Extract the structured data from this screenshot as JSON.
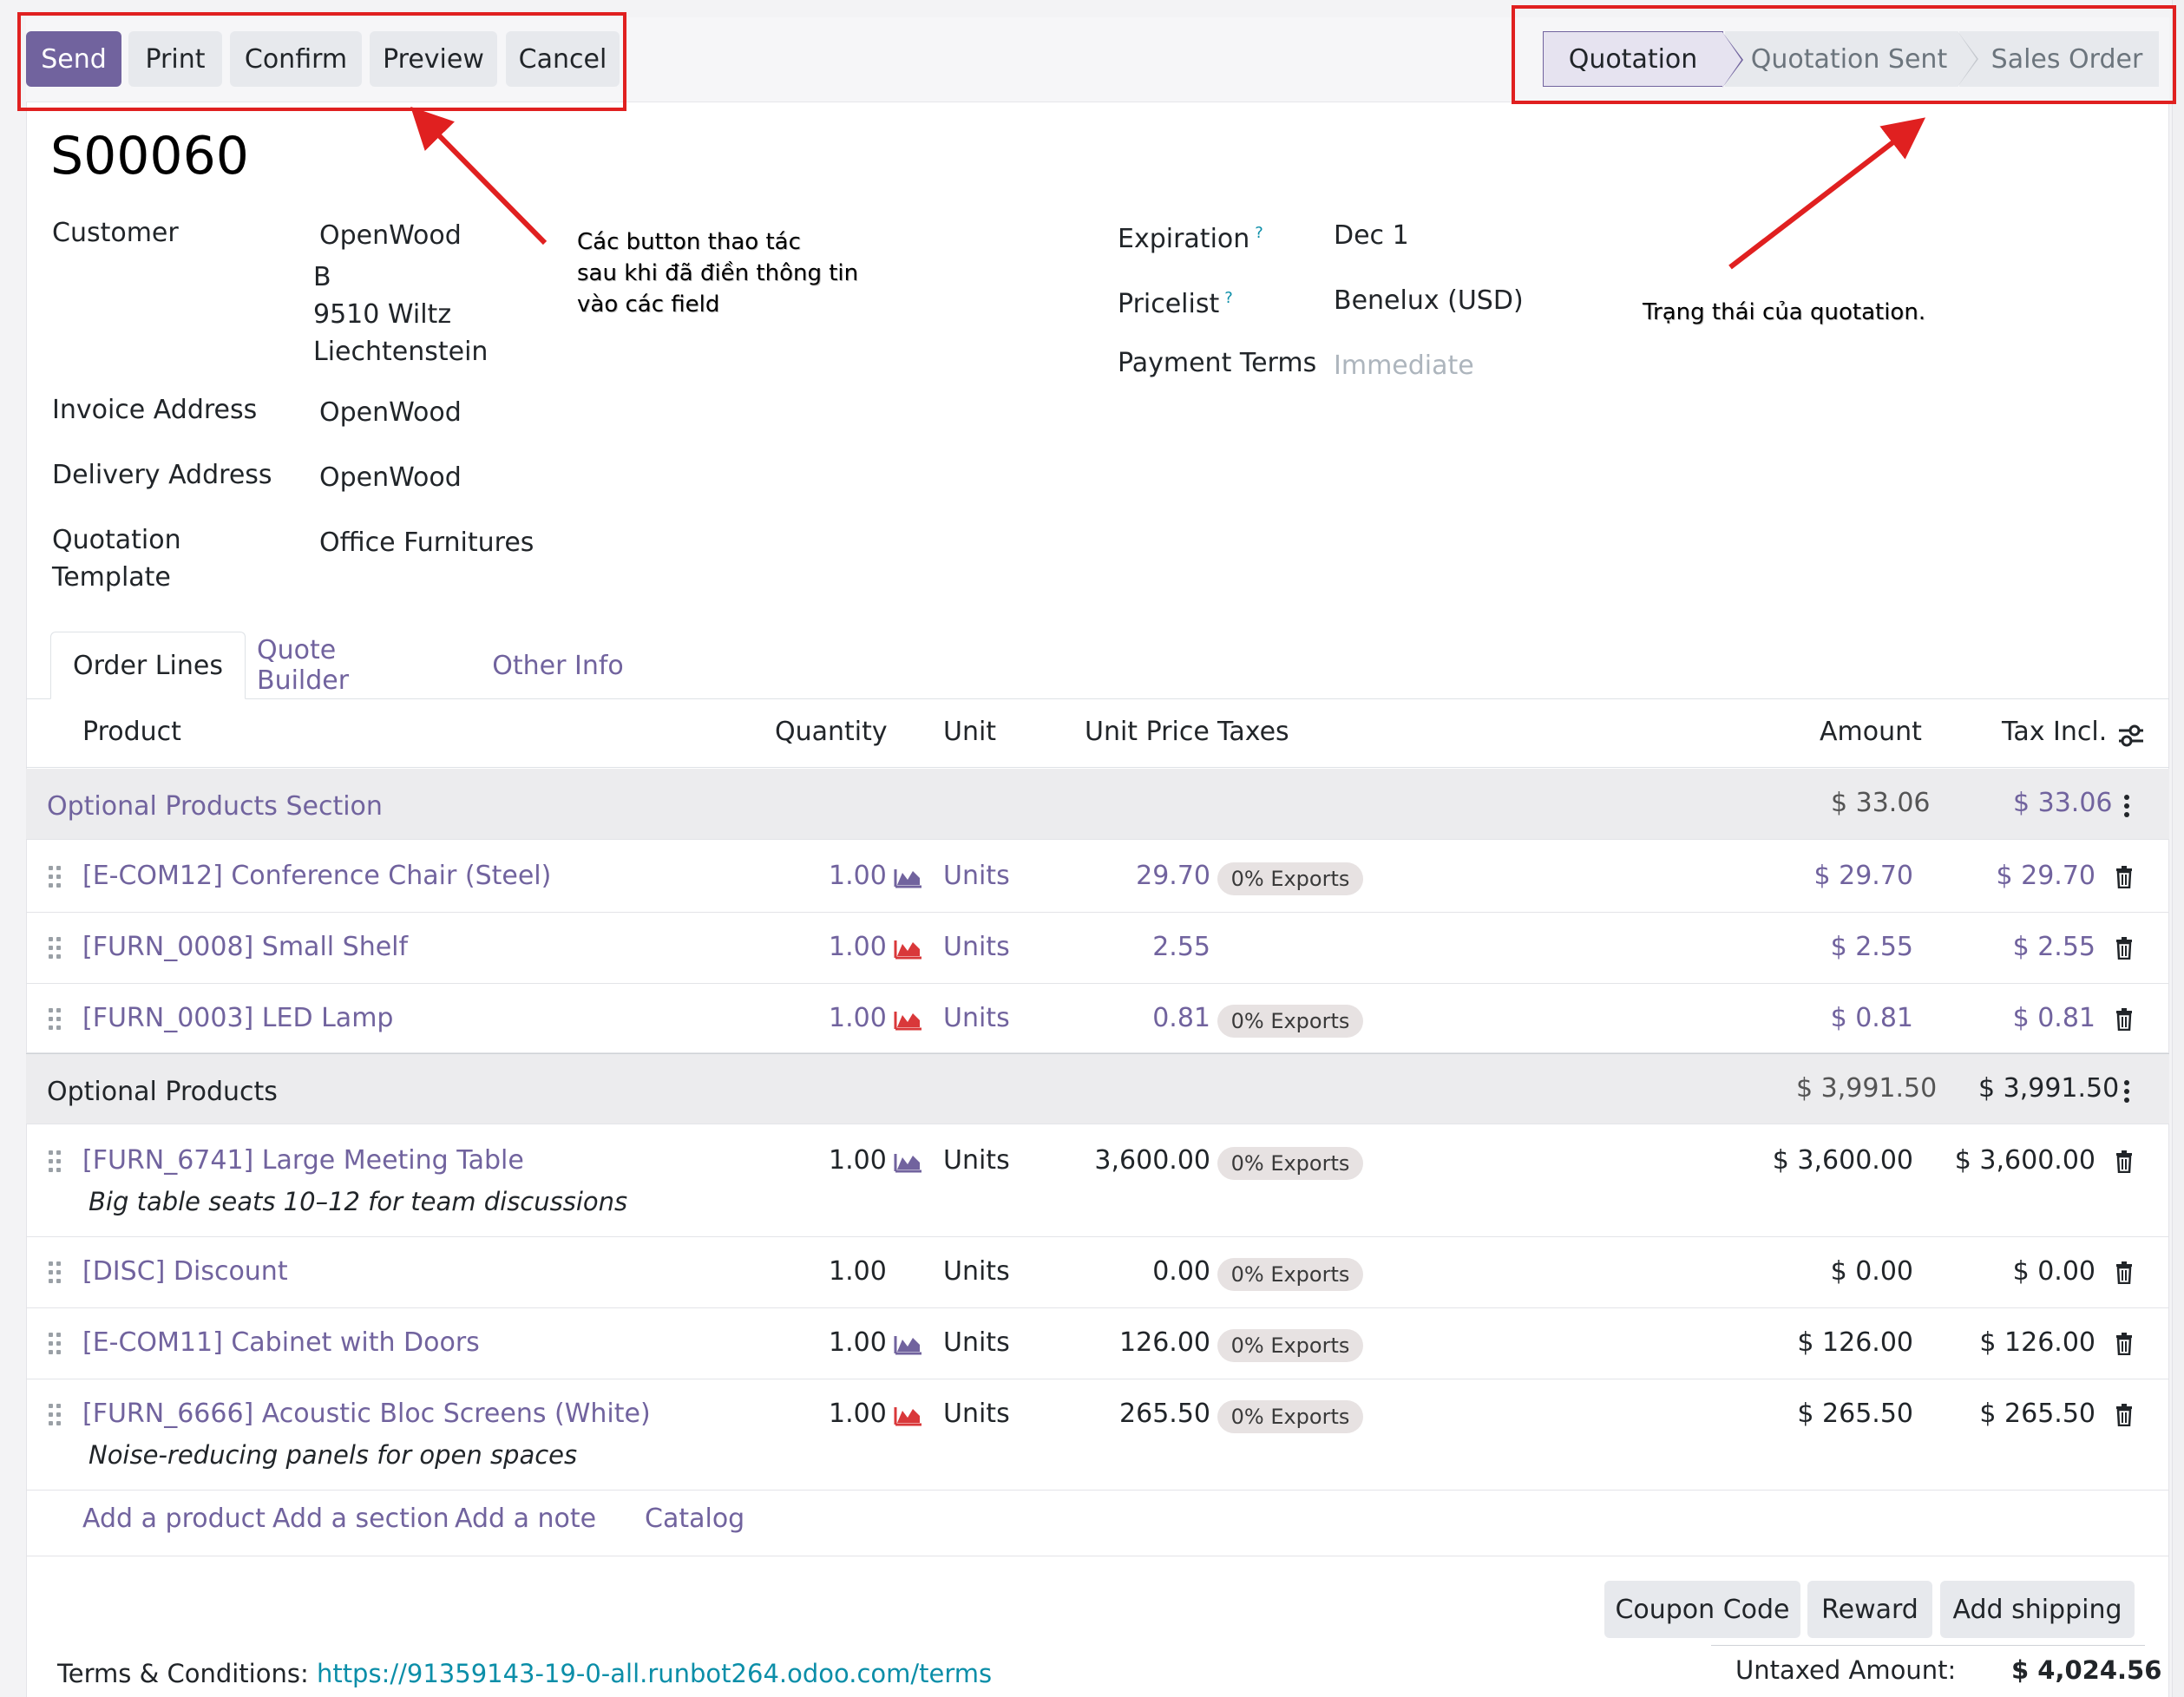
{
  "toolbar": {
    "send": "Send",
    "print": "Print",
    "confirm": "Confirm",
    "preview": "Preview",
    "cancel": "Cancel"
  },
  "statusbar": {
    "stages": [
      "Quotation",
      "Quotation Sent",
      "Sales Order"
    ],
    "active": "Quotation"
  },
  "annotations": {
    "buttons_note": "Các button thao tác\nsau khi đã điền thông tin\nvào các field",
    "status_note": "Trạng thái của quotation."
  },
  "record": {
    "name": "S00060",
    "customer_label": "Customer",
    "customer_name": "OpenWood",
    "customer_addr1": "B",
    "customer_addr2": "9510 Wiltz",
    "customer_addr3": "Liechtenstein",
    "invoice_label": "Invoice Address",
    "invoice_value": "OpenWood",
    "delivery_label": "Delivery Address",
    "delivery_value": "OpenWood",
    "template_label_1": "Quotation",
    "template_label_2": "Template",
    "template_value": "Office Furnitures",
    "expiration_label": "Expiration",
    "expiration_value": "Dec 1",
    "pricelist_label": "Pricelist",
    "pricelist_value": "Benelux (USD)",
    "payment_terms_label": "Payment Terms",
    "payment_terms_placeholder": "Immediate",
    "help_mark": "?"
  },
  "tabs": [
    "Order Lines",
    "Quote Builder",
    "Other Info"
  ],
  "table": {
    "headers": {
      "product": "Product",
      "quantity": "Quantity",
      "unit": "Unit",
      "unit_price": "Unit Price",
      "taxes": "Taxes",
      "amount": "Amount",
      "tax_incl": "Tax Incl."
    },
    "sections": [
      {
        "name": "Optional Products Section",
        "amount": "$ 33.06",
        "tax_incl": "$ 33.06"
      },
      {
        "name": "Optional Products",
        "amount": "$ 3,991.50",
        "tax_incl": "$ 3,991.50"
      }
    ],
    "lines": [
      {
        "product": "[E-COM12] Conference Chair (Steel)",
        "qty": "1.00",
        "unit": "Units",
        "price": "29.70",
        "tax": "0% Exports",
        "amount": "$ 29.70",
        "tax_incl": "$ 29.70",
        "forecast": "purple"
      },
      {
        "product": "[FURN_0008] Small Shelf",
        "qty": "1.00",
        "unit": "Units",
        "price": "2.55",
        "tax": "",
        "amount": "$ 2.55",
        "tax_incl": "$ 2.55",
        "forecast": "red"
      },
      {
        "product": "[FURN_0003] LED Lamp",
        "qty": "1.00",
        "unit": "Units",
        "price": "0.81",
        "tax": "0% Exports",
        "amount": "$ 0.81",
        "tax_incl": "$ 0.81",
        "forecast": "red"
      },
      {
        "product": "[FURN_6741] Large Meeting Table",
        "description": "Big table seats 10–12 for team discussions",
        "qty": "1.00",
        "unit": "Units",
        "price": "3,600.00",
        "tax": "0% Exports",
        "amount": "$ 3,600.00",
        "tax_incl": "$ 3,600.00",
        "forecast": "purple"
      },
      {
        "product": "[DISC] Discount",
        "qty": "1.00",
        "unit": "Units",
        "price": "0.00",
        "tax": "0% Exports",
        "amount": "$ 0.00",
        "tax_incl": "$ 0.00",
        "forecast": ""
      },
      {
        "product": "[E-COM11] Cabinet with Doors",
        "qty": "1.00",
        "unit": "Units",
        "price": "126.00",
        "tax": "0% Exports",
        "amount": "$ 126.00",
        "tax_incl": "$ 126.00",
        "forecast": "purple"
      },
      {
        "product": "[FURN_6666] Acoustic Bloc Screens (White)",
        "description": "Noise-reducing panels for open spaces",
        "qty": "1.00",
        "unit": "Units",
        "price": "265.50",
        "tax": "0% Exports",
        "amount": "$ 265.50",
        "tax_incl": "$ 265.50",
        "forecast": "red"
      }
    ]
  },
  "add_links": {
    "product": "Add a product",
    "section": "Add a section",
    "note": "Add a note",
    "catalog": "Catalog"
  },
  "bottom_buttons": {
    "coupon": "Coupon Code",
    "reward": "Reward",
    "shipping": "Add shipping"
  },
  "footer": {
    "terms_label": "Terms & Conditions:",
    "terms_url": "https://91359143-19-0-all.runbot264.odoo.com/terms",
    "untaxed_label": "Untaxed Amount:",
    "untaxed_value": "$ 4,024.56"
  },
  "colors": {
    "primary": "#71639e",
    "link_teal": "#0b8ea8",
    "annotation_red": "#e02020",
    "forecast_purple": "#71639e",
    "forecast_red": "#d9383a"
  }
}
